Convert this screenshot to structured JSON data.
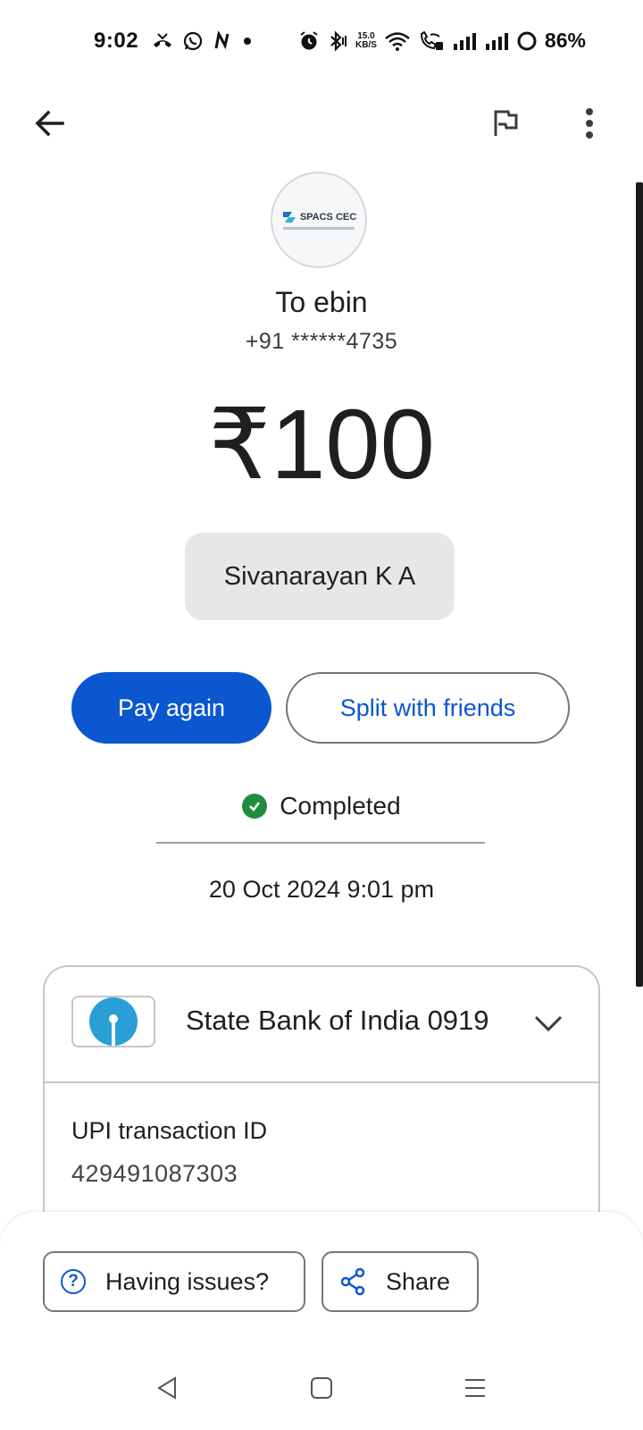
{
  "status_bar": {
    "time": "9:02",
    "network_speed_value": "15.0",
    "network_speed_unit": "KB/S",
    "battery": "86%",
    "icons": [
      "missed-call-icon",
      "whatsapp-icon",
      "n-notification-icon",
      "dot-icon",
      "alarm-icon",
      "bluetooth-icon",
      "wifi-icon",
      "wifi-calling-icon",
      "signal-bars-icon",
      "signal-bars-icon",
      "battery-icon"
    ]
  },
  "app_bar": {
    "back_icon": "arrow-back-icon",
    "report_icon": "flag-icon",
    "more_icon": "more-vert-icon"
  },
  "recipient": {
    "avatar_logo_text": "SPACS CEC",
    "to_label": "To ebin",
    "phone": "+91 ******4735"
  },
  "amount": "₹100",
  "payer_name": "Sivanarayan K A",
  "actions": {
    "pay_again": "Pay again",
    "split": "Split with friends"
  },
  "transaction": {
    "status": "Completed",
    "datetime": "20 Oct 2024 9:01 pm",
    "bank_account": "State Bank of India 0919",
    "upi_label": "UPI transaction ID",
    "upi_id": "429491087303"
  },
  "bottom_actions": {
    "issues": "Having issues?",
    "share": "Share"
  },
  "colors": {
    "primary": "#0b57d0",
    "success": "#1e8e3e",
    "chip_bg": "#e6e8e6",
    "sbi_blue": "#2a9fd6"
  }
}
